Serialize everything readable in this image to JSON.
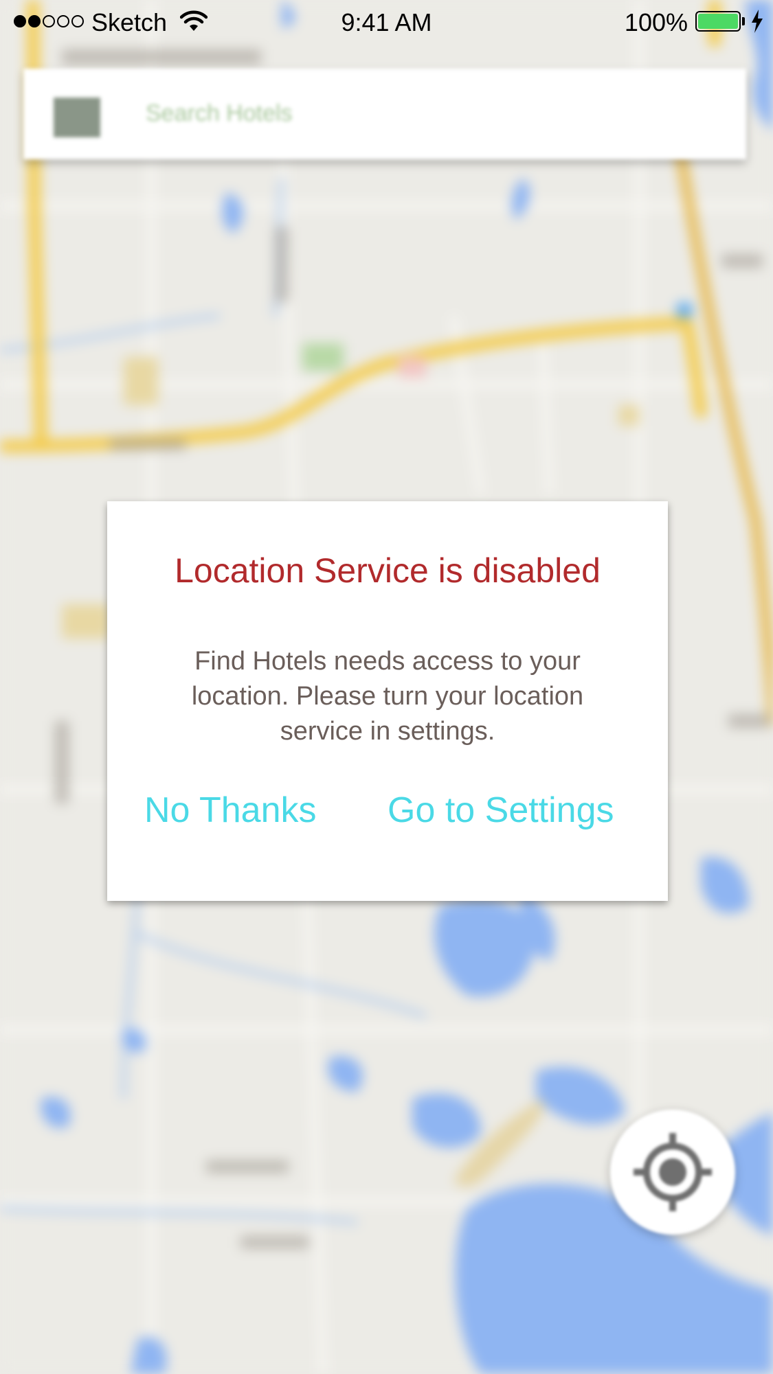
{
  "status_bar": {
    "carrier": "Sketch",
    "time": "9:41 AM",
    "battery_percent": "100%",
    "signal_bars_filled": 2,
    "signal_bars_total": 5,
    "battery_color": "#4cd964"
  },
  "search": {
    "placeholder": "Search Hotels",
    "icon": "menu-icon"
  },
  "dialog": {
    "title": "Location Service is disabled",
    "message": "Find Hotels needs access to your location. Please turn your location service in settings.",
    "buttons": {
      "no_thanks": "No Thanks",
      "go_to_settings": "Go to Settings"
    },
    "title_color": "#b12a2c",
    "message_color": "#6a5e5a",
    "button_color": "#4ad9e6"
  },
  "map": {
    "locate_button_icon": "crosshair-icon"
  }
}
